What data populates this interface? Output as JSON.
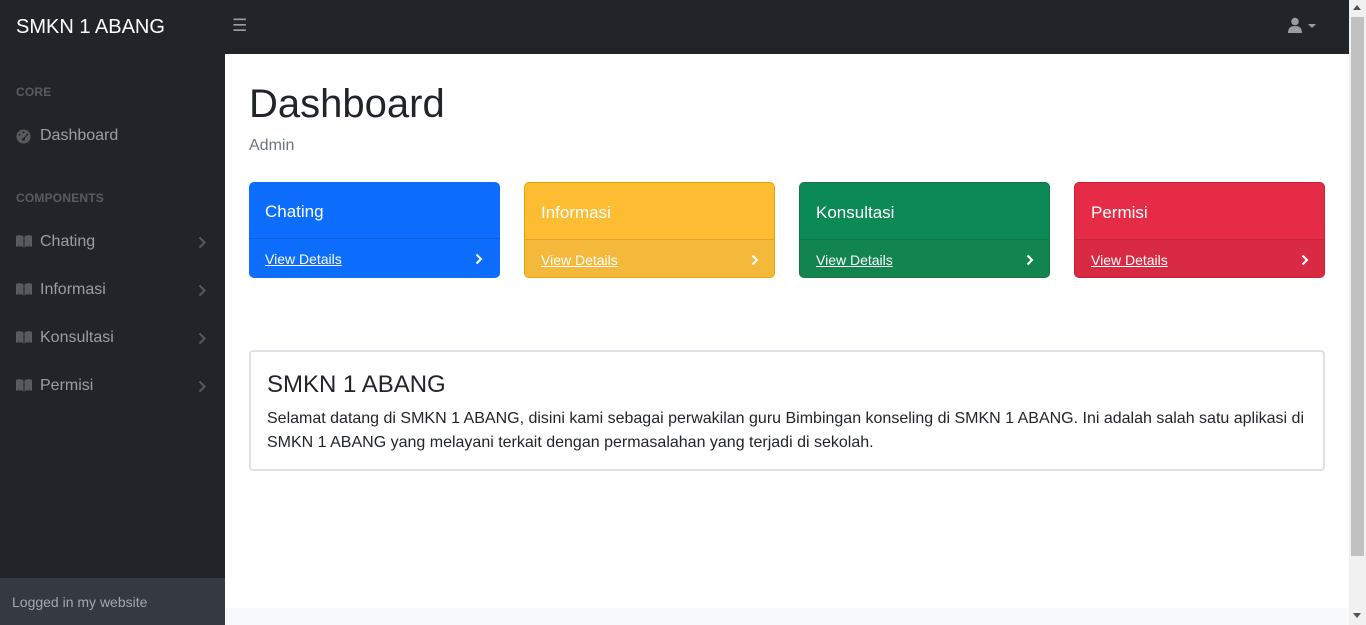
{
  "topbar": {
    "brand": "SMKN 1 ABANG",
    "toggle_icon": "bars-icon",
    "user_icon": "user-icon"
  },
  "sidebar": {
    "core_heading": "CORE",
    "dashboard_label": "Dashboard",
    "components_heading": "COMPONENTS",
    "items": [
      {
        "label": "Chating",
        "icon": "book-open-icon"
      },
      {
        "label": "Informasi",
        "icon": "book-open-icon"
      },
      {
        "label": "Konsultasi",
        "icon": "book-open-icon"
      },
      {
        "label": "Permisi",
        "icon": "book-open-icon"
      }
    ],
    "footer": "Logged in my website"
  },
  "main": {
    "title": "Dashboard",
    "breadcrumb": "Admin",
    "cards": [
      {
        "title": "Chating",
        "link": "View Details",
        "color": "#0d6efd"
      },
      {
        "title": "Informasi",
        "link": "View Details",
        "color": "#ffc107"
      },
      {
        "title": "Konsultasi",
        "link": "View Details",
        "color": "#198754"
      },
      {
        "title": "Permisi",
        "link": "View Details",
        "color": "#dc3545"
      }
    ],
    "welcome": {
      "heading": "SMKN 1 ABANG",
      "text": "Selamat datang di SMKN 1 ABANG, disini kami sebagai perwakilan guru Bimbingan konseling di SMKN 1 ABANG. Ini adalah salah satu aplikasi di SMKN 1 ABANG yang melayani terkait dengan permasalahan yang terjadi di sekolah."
    }
  }
}
